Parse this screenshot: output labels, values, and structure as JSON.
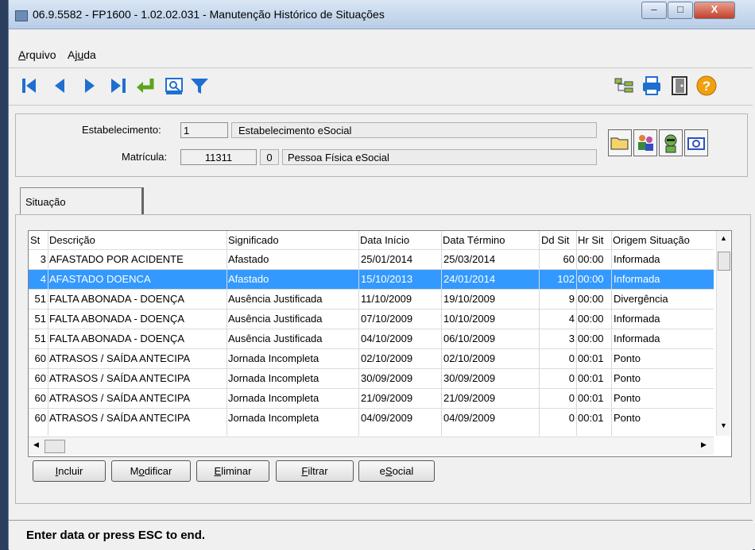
{
  "window": {
    "title": "06.9.5582 - FP1600 - 1.02.02.031 - Manutenção Histórico de Situações",
    "controls": {
      "minimize": "–",
      "maximize": "□",
      "close": "X"
    }
  },
  "menu": {
    "arquivo": {
      "pre": "",
      "key": "A",
      "post": "rquivo"
    },
    "ajuda": {
      "pre": "Aj",
      "key": "u",
      "post": "da"
    }
  },
  "toolbar_icons": [
    "first-record-icon",
    "previous-record-icon",
    "next-record-icon",
    "last-record-icon",
    "enter-icon",
    "preview-icon",
    "filter-icon",
    "tree-icon",
    "print-icon",
    "exit-door-icon",
    "help-icon"
  ],
  "header": {
    "estabelecimento_label": "Estabelecimento:",
    "estabelecimento_code": "1",
    "estabelecimento_name": "Estabelecimento eSocial",
    "matricula_label": "Matrícula:",
    "matricula_value": "11311",
    "matricula_digit": "0",
    "pessoa_name": "Pessoa Física eSocial"
  },
  "tab": {
    "label": "Situação"
  },
  "grid": {
    "columns": [
      "St",
      "Descrição",
      "Significado",
      "Data Início",
      "Data Término",
      "Dd Sit",
      "Hr Sit",
      "Origem Situação"
    ],
    "rows": [
      {
        "st": "3",
        "desc": "AFASTADO POR ACIDENTE",
        "sig": "Afastado",
        "ini": "25/01/2014",
        "fim": "25/03/2014",
        "dd": "60",
        "hr": "00:00",
        "orig": "Informada"
      },
      {
        "st": "4",
        "desc": "AFASTADO DOENCA",
        "sig": "Afastado",
        "ini": "15/10/2013",
        "fim": "24/01/2014",
        "dd": "102",
        "hr": "00:00",
        "orig": "Informada"
      },
      {
        "st": "51",
        "desc": "FALTA ABONADA - DOENÇA",
        "sig": "Ausência Justificada",
        "ini": "11/10/2009",
        "fim": "19/10/2009",
        "dd": "9",
        "hr": "00:00",
        "orig": "Divergência"
      },
      {
        "st": "51",
        "desc": "FALTA ABONADA - DOENÇA",
        "sig": "Ausência Justificada",
        "ini": "07/10/2009",
        "fim": "10/10/2009",
        "dd": "4",
        "hr": "00:00",
        "orig": "Informada"
      },
      {
        "st": "51",
        "desc": "FALTA ABONADA - DOENÇA",
        "sig": "Ausência Justificada",
        "ini": "04/10/2009",
        "fim": "06/10/2009",
        "dd": "3",
        "hr": "00:00",
        "orig": "Informada"
      },
      {
        "st": "60",
        "desc": "ATRASOS / SAÍDA ANTECIPA",
        "sig": "Jornada Incompleta",
        "ini": "02/10/2009",
        "fim": "02/10/2009",
        "dd": "0",
        "hr": "00:01",
        "orig": "Ponto"
      },
      {
        "st": "60",
        "desc": "ATRASOS / SAÍDA ANTECIPA",
        "sig": "Jornada Incompleta",
        "ini": "30/09/2009",
        "fim": "30/09/2009",
        "dd": "0",
        "hr": "00:01",
        "orig": "Ponto"
      },
      {
        "st": "60",
        "desc": "ATRASOS / SAÍDA ANTECIPA",
        "sig": "Jornada Incompleta",
        "ini": "21/09/2009",
        "fim": "21/09/2009",
        "dd": "0",
        "hr": "00:01",
        "orig": "Ponto"
      },
      {
        "st": "60",
        "desc": "ATRASOS / SAÍDA ANTECIPA",
        "sig": "Jornada Incompleta",
        "ini": "04/09/2009",
        "fim": "04/09/2009",
        "dd": "0",
        "hr": "00:01",
        "orig": "Ponto"
      }
    ],
    "selected_row": 1
  },
  "actions": {
    "incluir": {
      "key": "I",
      "rest": "ncluir"
    },
    "modificar": {
      "pre": "M",
      "key": "o",
      "rest": "dificar"
    },
    "eliminar": {
      "key": "E",
      "rest": "liminar"
    },
    "filtrar": {
      "key": "F",
      "rest": "iltrar"
    },
    "esocial": {
      "pre": "e",
      "key": "S",
      "rest": "ocial"
    }
  },
  "status": {
    "text": "Enter data or press ESC to end."
  },
  "colors": {
    "selection": "#3399ff",
    "toolbar_blue": "#1f6fd0",
    "enter_green": "#5aa51a",
    "help_orange": "#f0a010"
  }
}
